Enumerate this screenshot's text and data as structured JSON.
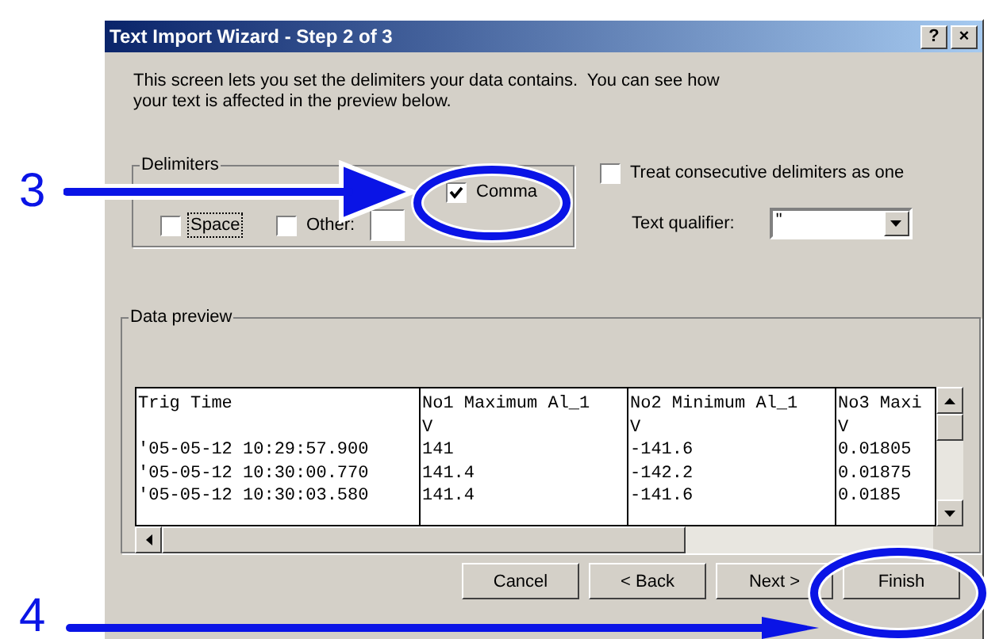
{
  "window": {
    "title": "Text Import Wizard - Step 2 of 3",
    "controls": [
      "?",
      "×"
    ]
  },
  "intro": "This screen lets you set the delimiters your data contains.  You can see how your text is affected in the preview below.",
  "delimiters": {
    "label": "Delimiters",
    "options": [
      {
        "label": "Comma",
        "checked": true,
        "focused": false
      },
      {
        "label": "Space",
        "checked": false,
        "focused": true
      },
      {
        "label": "Other:",
        "checked": false,
        "focused": false,
        "kind": "with_field"
      }
    ]
  },
  "consecutive": {
    "label": "Treat consecutive delimiters as one",
    "checked": false
  },
  "text_qualifier": {
    "label": "Text qualifier:",
    "value": "\""
  },
  "preview": {
    "label": "Data preview",
    "columns": [
      {
        "header": "Trig Time"
      },
      {
        "header": "No1 Maximum Al_1",
        "unit": "V"
      },
      {
        "header": "No2 Minimum Al_1",
        "unit": "V"
      },
      {
        "header": "No3 Maxi",
        "unit": "V"
      }
    ],
    "rows": [
      [
        "'05-05-12 10:29:57.900",
        "141",
        "-141.6",
        "0.01805"
      ],
      [
        "'05-05-12 10:30:00.770",
        "141.4",
        "-142.2",
        "0.01875"
      ],
      [
        "'05-05-12 10:30:03.580",
        "141.4",
        "-141.6",
        "0.0185"
      ]
    ]
  },
  "buttons": [
    "Cancel",
    "< Back",
    "Next >",
    "Finish"
  ],
  "annotations": [
    {
      "label": "3",
      "kind": "comma"
    },
    {
      "label": "4",
      "kind": "finish"
    }
  ]
}
